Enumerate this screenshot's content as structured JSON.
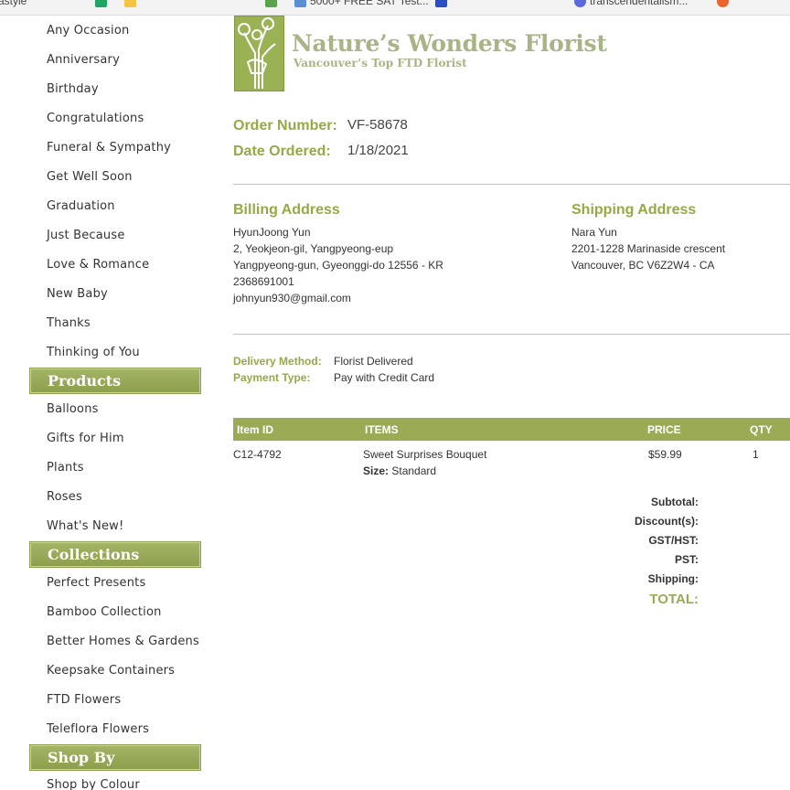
{
  "browser": {
    "bookmarks": [
      "astyle",
      "",
      "",
      "",
      "5000+ FREE SAT Test...",
      "",
      "",
      "transcendentalism...",
      ""
    ]
  },
  "sidebar": {
    "occasions": [
      "Any Occasion",
      "Anniversary",
      "Birthday",
      "Congratulations",
      "Funeral & Sympathy",
      "Get Well Soon",
      "Graduation",
      "Just Because",
      "Love & Romance",
      "New Baby",
      "Thanks",
      "Thinking of You"
    ],
    "products_header": "Products",
    "products": [
      "Balloons",
      "Gifts for Him",
      "Plants",
      "Roses",
      "What's New!"
    ],
    "collections_header": "Collections",
    "collections": [
      "Perfect Presents",
      "Bamboo Collection",
      "Better Homes & Gardens",
      "Keepsake Containers",
      "FTD Flowers",
      "Teleflora Flowers"
    ],
    "shopby_header": "Shop By",
    "shopby": [
      "Shop by Colour"
    ]
  },
  "header": {
    "title": "Nature’s Wonders Florist",
    "subtitle": "Vancouver’s Top FTD Florist"
  },
  "order": {
    "number_label": "Order Number:",
    "number": "VF-58678",
    "date_label": "Date Ordered:",
    "date": "1/18/2021"
  },
  "billing": {
    "heading": "Billing Address",
    "lines": [
      "HyunJoong Yun",
      "2, Yeokjeon-gil, Yangpyeong-eup",
      "Yangpyeong-gun, Gyeonggi-do 12556 - KR",
      "2368691001",
      "johnyun930@gmail.com"
    ]
  },
  "shipping": {
    "heading": "Shipping Address",
    "lines": [
      "Nara Yun",
      "2201-1228 Marinaside crescent",
      "Vancouver, BC V6Z2W4 - CA"
    ]
  },
  "delivery": {
    "method_label": "Delivery Method:",
    "method": "Florist Delivered",
    "payment_label": "Payment Type:",
    "payment": "Pay with Credit Card"
  },
  "items_table": {
    "columns": [
      "Item ID",
      "ITEMS",
      "PRICE",
      "QTY"
    ],
    "rows": [
      {
        "id": "C12-4792",
        "name": "Sweet Surprises Bouquet",
        "size_label": "Size:",
        "size": "Standard",
        "price": "$59.99",
        "qty": "1"
      }
    ]
  },
  "totals": {
    "subtotal": "Subtotal:",
    "discount": "Discount(s):",
    "gst": "GST/HST:",
    "pst": "PST:",
    "shipping": "Shipping:",
    "total": "TOTAL:"
  },
  "colors": {
    "accent_green": "#9aaa55",
    "logo_text": "#a8b485",
    "rule": "#c9c0a8"
  }
}
